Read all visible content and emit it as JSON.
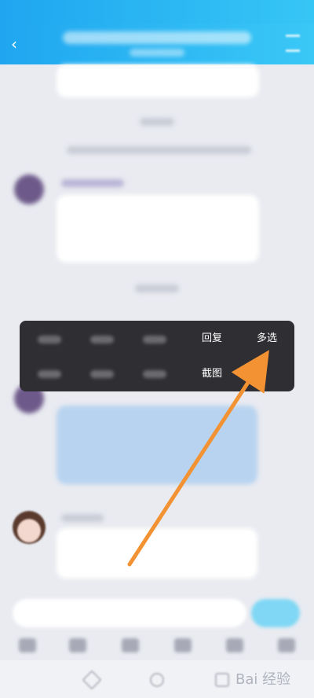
{
  "context_menu": {
    "reply_label": "回复",
    "multiselect_label": "多选",
    "screenshot_label": "截图"
  },
  "watermark": {
    "text": "Bai 经验"
  },
  "colors": {
    "header": "#1fa6f0",
    "menu_bg": "#2f2f33",
    "arrow": "#f39232"
  }
}
